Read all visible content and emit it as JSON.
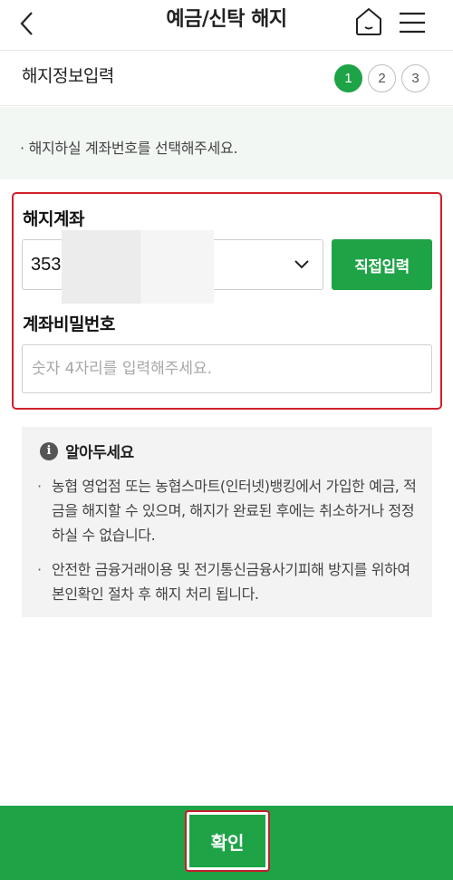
{
  "header": {
    "title": "예금/신탁 해지",
    "back_icon": "chevron-left-icon",
    "home_icon": "home-icon",
    "menu_icon": "hamburger-menu-icon"
  },
  "stepbar": {
    "title": "해지정보입력",
    "steps": [
      "1",
      "2",
      "3"
    ],
    "active_step": 1
  },
  "notice": {
    "text": "· 해지하실 계좌번호를 선택해주세요."
  },
  "form": {
    "account_label": "해지계좌",
    "account_value": "353",
    "direct_input_label": "직접입력",
    "password_label": "계좌비밀번호",
    "password_placeholder": "숫자 4자리를 입력해주세요."
  },
  "info": {
    "title": "알아두세요",
    "icon": "info-icon",
    "items": [
      "농협 영업점 또는 농협스마트(인터넷)뱅킹에서 가입한 예금, 적금을 해지할 수 있으며, 해지가 완료된 후에는 취소하거나 정정하실 수 없습니다.",
      "안전한 금융거래이용 및 전기통신금융사기피해 방지를 위하여 본인확인 절차 후 해지 처리 됩니다."
    ]
  },
  "footer": {
    "confirm_label": "확인"
  },
  "colors": {
    "primary_green": "#1fa347",
    "highlight_red": "#d0202b"
  }
}
